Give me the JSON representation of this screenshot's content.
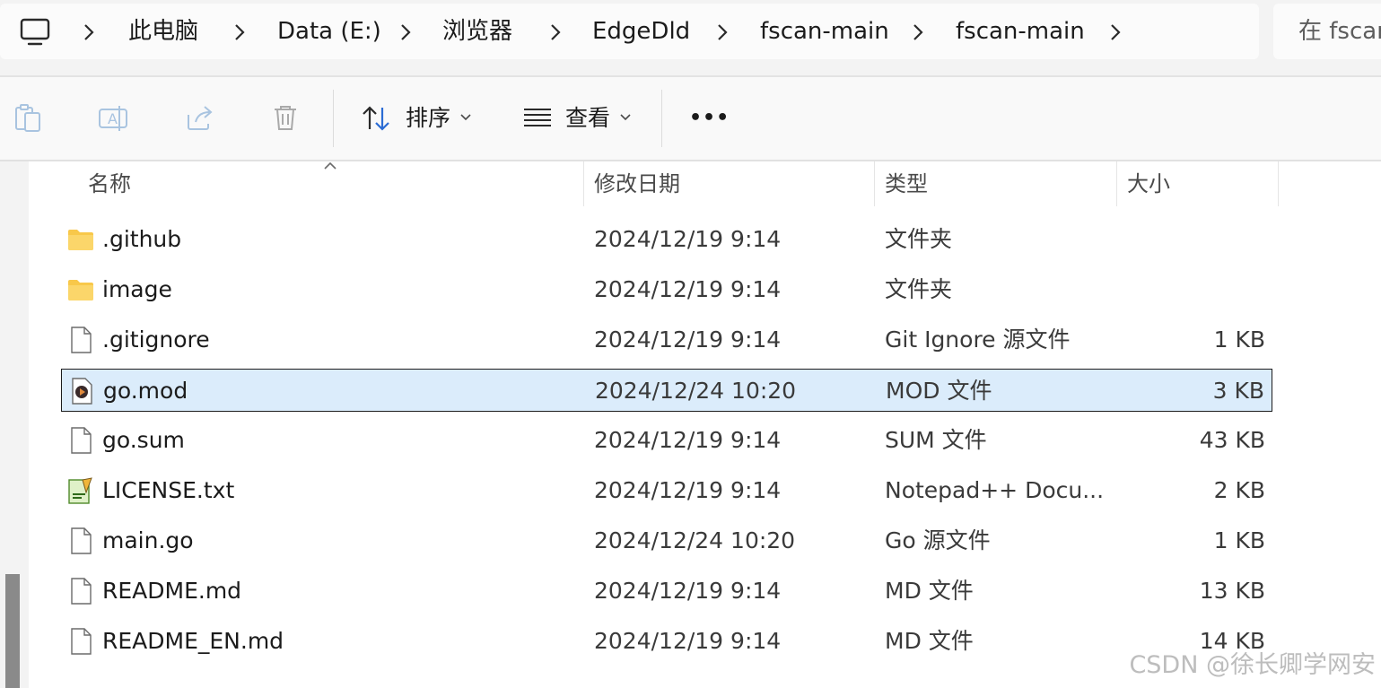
{
  "address_bar": {
    "breadcrumbs": [
      "此电脑",
      "Data (E:)",
      "浏览器",
      "EdgeDld",
      "fscan-main",
      "fscan-main"
    ],
    "search_placeholder": "在 fscan"
  },
  "command_bar": {
    "sort_label": "排序",
    "view_label": "查看",
    "more_label": "•••"
  },
  "columns": {
    "name": "名称",
    "modified": "修改日期",
    "type": "类型",
    "size": "大小"
  },
  "files": [
    {
      "icon": "folder-icon",
      "name": ".github",
      "modified": "2024/12/19 9:14",
      "type": "文件夹",
      "size": "",
      "selected": false
    },
    {
      "icon": "folder-icon",
      "name": "image",
      "modified": "2024/12/19 9:14",
      "type": "文件夹",
      "size": "",
      "selected": false
    },
    {
      "icon": "file-icon",
      "name": ".gitignore",
      "modified": "2024/12/19 9:14",
      "type": "Git Ignore 源文件",
      "size": "1 KB",
      "selected": false
    },
    {
      "icon": "media-file-icon",
      "name": "go.mod",
      "modified": "2024/12/24 10:20",
      "type": "MOD 文件",
      "size": "3 KB",
      "selected": true
    },
    {
      "icon": "file-icon",
      "name": "go.sum",
      "modified": "2024/12/19 9:14",
      "type": "SUM 文件",
      "size": "43 KB",
      "selected": false
    },
    {
      "icon": "notepad-plus-plus-icon",
      "name": "LICENSE.txt",
      "modified": "2024/12/19 9:14",
      "type": "Notepad++ Docu...",
      "size": "2 KB",
      "selected": false
    },
    {
      "icon": "file-icon",
      "name": "main.go",
      "modified": "2024/12/24 10:20",
      "type": "Go 源文件",
      "size": "1 KB",
      "selected": false
    },
    {
      "icon": "file-icon",
      "name": "README.md",
      "modified": "2024/12/19 9:14",
      "type": "MD 文件",
      "size": "13 KB",
      "selected": false
    },
    {
      "icon": "file-icon",
      "name": "README_EN.md",
      "modified": "2024/12/19 9:14",
      "type": "MD 文件",
      "size": "14 KB",
      "selected": false
    }
  ],
  "watermark": "CSDN @徐长卿学网安",
  "colors": {
    "selection_bg": "#dbecfb",
    "folder_yellow": "#f8c84a",
    "accent_blue": "#2b6cd4"
  }
}
